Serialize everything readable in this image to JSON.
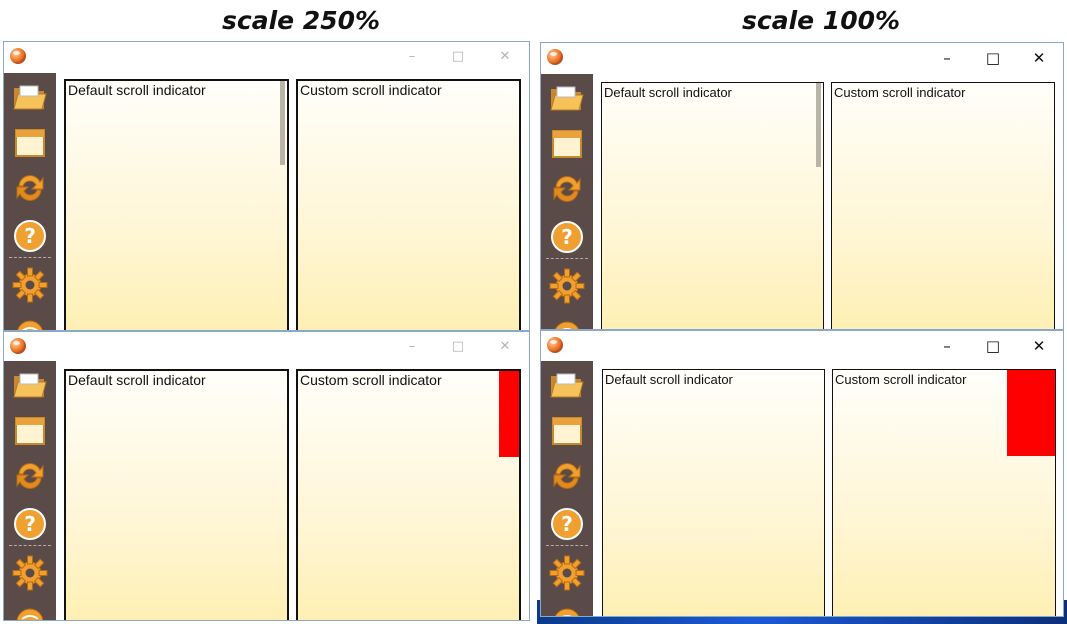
{
  "headings": {
    "left": "scale 250%",
    "right": "scale 100%"
  },
  "window": {
    "app_icon": "firefox-like-orange-globe-icon",
    "controls": {
      "minimize": "–",
      "maximize": "□",
      "close": "✕"
    }
  },
  "sidebar": {
    "items": [
      {
        "name": "open-folder-icon"
      },
      {
        "name": "window-icon"
      },
      {
        "name": "refresh-icon"
      },
      {
        "name": "help-icon",
        "glyph": "?"
      },
      {
        "name": "settings-gear-icon"
      },
      {
        "name": "exit-ball-icon"
      }
    ]
  },
  "panes": {
    "default_label": "Default scroll indicator",
    "custom_label": "Custom scroll indicator"
  },
  "colors": {
    "sidebar_bg": "#5a4a48",
    "custom_indicator": "#ff0000",
    "default_indicator": "#b9b4a8",
    "pane_gradient_top": "#fffefa",
    "pane_gradient_bottom": "#fef0b4"
  }
}
